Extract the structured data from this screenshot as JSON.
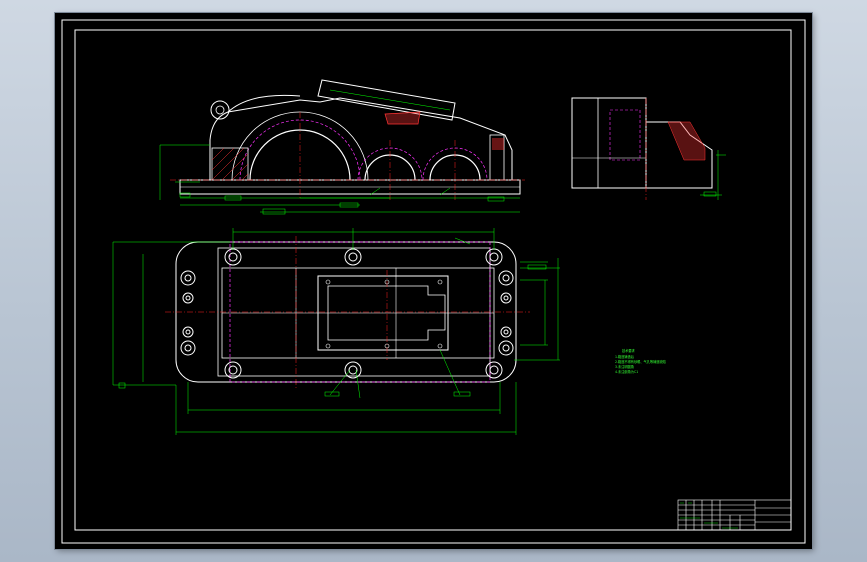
{
  "drawing": {
    "title_block": {
      "rows": 6
    },
    "notes": {
      "heading": "技术要求",
      "lines": [
        "1.箱座铸造后",
        "2.箱座不得有砂眼、气孔等铸造缺陷",
        "3.未注明圆角",
        "4.未注倒角为C1"
      ]
    },
    "colors": {
      "background": "#000000",
      "geometry": "#ffffff",
      "dimension": "#00ff00",
      "centerline": "#ff2020",
      "hidden": "#ff33ff",
      "hatch": "#ff3333"
    }
  }
}
